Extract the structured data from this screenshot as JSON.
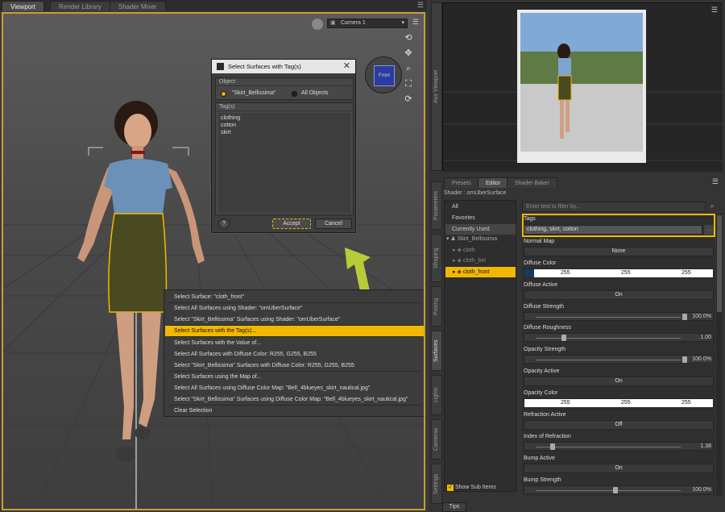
{
  "tabs": {
    "viewport": "Viewport",
    "render_library": "Render Library",
    "shader_mixer": "Shader Mixer"
  },
  "viewport": {
    "camera": "Camera 1",
    "cube_face": "Front"
  },
  "dialog": {
    "title": "Select Surfaces with Tag(s)",
    "object_label": "Object",
    "option_skirt": "\"Skirt_Bellissima\"",
    "option_all": "All Objects",
    "tags_label": "Tag(s)",
    "tags": [
      "clothing",
      "cotton",
      "skirt"
    ],
    "help": "?",
    "accept": "Accept",
    "cancel": "Cancel"
  },
  "context_menu": {
    "items": [
      "Select Surface: \"cloth_front\"",
      "Select All Surfaces using Shader: \"omUberSurface\"",
      "Select \"Skirt_Bellissima\" Surfaces using Shader: \"omUberSurface\"",
      "Select Surfaces with the Tag(s)...",
      "Select Surfaces with the Value of...",
      "Select All Surfaces with Diffuse Color: R255, G255, B255",
      "Select \"Skirt_Bellissima\" Surfaces with Diffuse Color: R255, G255, B255",
      "Select Surfaces using the Map of...",
      "Select All Surfaces using Diffuse Color Map: \"Bell_4blueyes_skirt_nautical.jpg\"",
      "Select \"Skirt_Bellissima\" Surfaces using Diffuse Color Map: \"Bell_4blueyes_skirt_nautical.jpg\"",
      "Clear Selection"
    ],
    "highlight_color": "#f2b800"
  },
  "right": {
    "aux_viewport_tab": "Aux Viewport",
    "side_tabs": [
      "Parameters",
      "Shaping",
      "Posing",
      "Surfaces",
      "Lights",
      "Cameras",
      "Settings"
    ],
    "panel_tabs": [
      "Presets",
      "Editor",
      "Shader Baker"
    ],
    "shader_label": "Shader : omUberSurface",
    "categories": [
      "All",
      "Favorites",
      "Currently Used"
    ],
    "tree": {
      "root": "Skirt_Bellissima",
      "children": [
        "cloth",
        "cloth_bel",
        "cloth_front"
      ]
    },
    "filter_placeholder": "Enter text to filter by...",
    "show_sub_items": "Show Sub Items",
    "tips": "Tips",
    "properties": {
      "tags": {
        "label": "Tags",
        "value": "clothing, skirt, cotton"
      },
      "normal_map": {
        "label": "Normal Map",
        "value": "None"
      },
      "diffuse_color": {
        "label": "Diffuse Color",
        "r": "255",
        "g": "255",
        "b": "255"
      },
      "diffuse_active": {
        "label": "Diffuse Active",
        "value": "On"
      },
      "diffuse_strength": {
        "label": "Diffuse Strength",
        "value": "100.0%"
      },
      "diffuse_roughness": {
        "label": "Diffuse Roughness",
        "value": "1.00"
      },
      "opacity_strength": {
        "label": "Opacity Strength",
        "value": "100.0%"
      },
      "opacity_active": {
        "label": "Opacity Active",
        "value": "On"
      },
      "opacity_color": {
        "label": "Opacity Color",
        "r": "255",
        "g": "255",
        "b": "255"
      },
      "refraction_active": {
        "label": "Refraction Active",
        "value": "Off"
      },
      "index_of_refraction": {
        "label": "Index of Refraction",
        "value": "1.38"
      },
      "bump_active": {
        "label": "Bump Active",
        "value": "On"
      },
      "bump_strength": {
        "label": "Bump Strength",
        "value": "100.0%"
      }
    }
  },
  "colors": {
    "accent": "#f2b800",
    "arrow": "#b8cc3a",
    "selection": "#f2b800"
  }
}
